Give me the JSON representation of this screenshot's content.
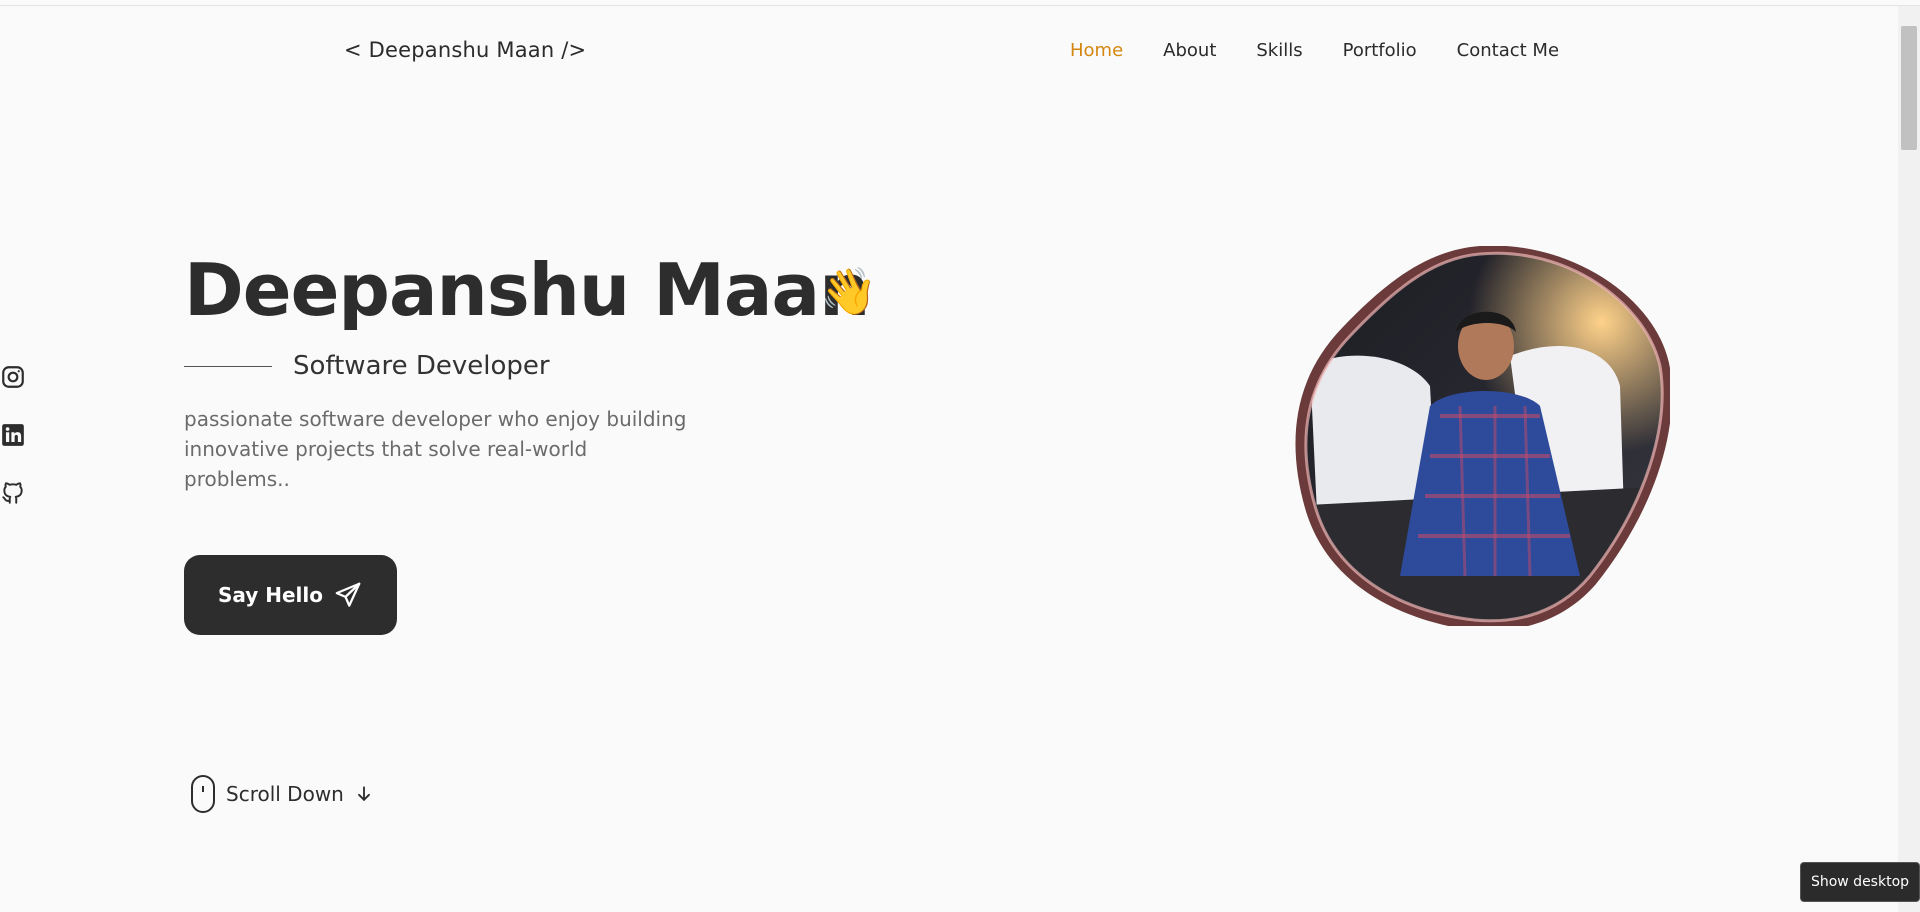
{
  "header": {
    "logo": "< Deepanshu Maan />",
    "nav": [
      {
        "label": "Home",
        "active": true
      },
      {
        "label": "About"
      },
      {
        "label": "Skills"
      },
      {
        "label": "Portfolio"
      },
      {
        "label": "Contact Me"
      }
    ]
  },
  "socials": [
    "instagram-icon",
    "linkedin-icon",
    "github-icon"
  ],
  "hero": {
    "name": "Deepanshu Maan",
    "wave": "👋",
    "role": "Software Developer",
    "description": "passionate software developer who enjoy building innovative projects that solve real-world problems..",
    "cta_label": "Say Hello",
    "scroll_label": "Scroll Down"
  },
  "colors": {
    "accent": "#d4870f",
    "dark": "#2d2d2d",
    "background": "#fafafa",
    "blob_border": "#6b3a3a"
  },
  "tooltip": "Show desktop"
}
